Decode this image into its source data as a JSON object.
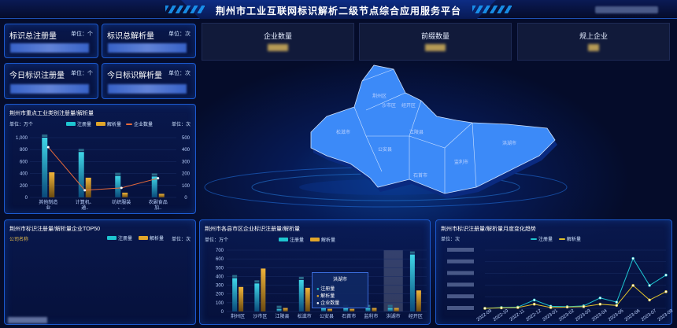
{
  "header": {
    "title": "荆州市工业互联网标识解析二级节点综合应用服务平台"
  },
  "kpis": [
    {
      "label": "标识总注册量",
      "unit": "单位：个"
    },
    {
      "label": "标识总解析量",
      "unit": "单位：次"
    },
    {
      "label": "今日标识注册量",
      "unit": "单位：个"
    },
    {
      "label": "今日标识解析量",
      "unit": "单位：次"
    }
  ],
  "topstats": [
    {
      "label": "企业数量"
    },
    {
      "label": "前缀数量"
    },
    {
      "label": "规上企业"
    }
  ],
  "industry": {
    "title": "荆州市重点工业类别注册量/解析量",
    "ylabel_left": "单位：万个",
    "ylabel_right": "单位：次",
    "legend": [
      "注册量",
      "解析量",
      "企业数量"
    ]
  },
  "top50": {
    "title": "荆州市标识注册量/解析量企业TOP50",
    "col": "公司名称",
    "unit": "单位：次",
    "legend": [
      "注册量",
      "解析量"
    ]
  },
  "county": {
    "title": "荆州市各县市区企业标识注册量/解析量",
    "ylabel": "单位：万个",
    "legend": [
      "注册量",
      "解析量"
    ],
    "tooltip": {
      "title": "洪湖市",
      "rows": [
        "注册量",
        "解析量",
        "企业数量"
      ]
    }
  },
  "trend": {
    "title": "荆州市标识注册量/解析量月度变化趋势",
    "ylabel": "单位：次",
    "legend": [
      "注册量",
      "解析量"
    ]
  },
  "map": {
    "regions": [
      "荆州区",
      "沙市区",
      "经开区",
      "松滋市",
      "江陵县",
      "公安县",
      "监利市",
      "石首市",
      "洪湖市"
    ]
  },
  "chart_data": [
    {
      "type": "bar",
      "title": "荆州市重点工业类别注册量/解析量",
      "categories": [
        "其他制造业",
        "计算机、通...",
        "纺织服装、...",
        "农副食品加..."
      ],
      "series": [
        {
          "name": "注册量",
          "values": [
            1000,
            760,
            360,
            350
          ]
        },
        {
          "name": "解析量",
          "values": [
            420,
            330,
            80,
            60
          ]
        },
        {
          "name": "企业数量",
          "values": [
            420,
            60,
            80,
            160
          ]
        }
      ],
      "ylim_left": [
        0,
        1000
      ],
      "ylim_right": [
        0,
        500
      ],
      "yticks_left": [
        0,
        200,
        400,
        600,
        800,
        1000
      ],
      "yticks_right": [
        0,
        100,
        200,
        300,
        400,
        500
      ]
    },
    {
      "type": "bar",
      "title": "荆州市各县市区企业标识注册量/解析量",
      "categories": [
        "荆州区",
        "沙市区",
        "江陵县",
        "松滋市",
        "公安县",
        "石首市",
        "监利市",
        "洪湖市",
        "经开区"
      ],
      "series": [
        {
          "name": "注册量",
          "values": [
            380,
            320,
            30,
            360,
            40,
            40,
            40,
            40,
            650
          ]
        },
        {
          "name": "解析量",
          "values": [
            280,
            490,
            40,
            270,
            30,
            30,
            40,
            40,
            240
          ]
        }
      ],
      "ylim": [
        0,
        700
      ],
      "yticks": [
        0,
        100,
        200,
        300,
        400,
        500,
        600,
        700
      ]
    },
    {
      "type": "line",
      "title": "荆州市标识注册量/解析量月度变化趋势",
      "categories": [
        "2022-09",
        "2022-10",
        "2022-11",
        "2022-12",
        "2023-01",
        "2023-02",
        "2023-03",
        "2023-04",
        "2023-05",
        "2023-06",
        "2023-07",
        "2023-08"
      ],
      "series": [
        {
          "name": "注册量",
          "values": [
            0,
            0.2,
            0.3,
            2,
            0.5,
            0.4,
            0.6,
            2.5,
            1.5,
            12,
            5.5,
            8
          ]
        },
        {
          "name": "解析量",
          "values": [
            0,
            0.1,
            0.2,
            1,
            0.2,
            0.3,
            0.4,
            1,
            0.7,
            5.5,
            2,
            4
          ]
        }
      ]
    }
  ]
}
